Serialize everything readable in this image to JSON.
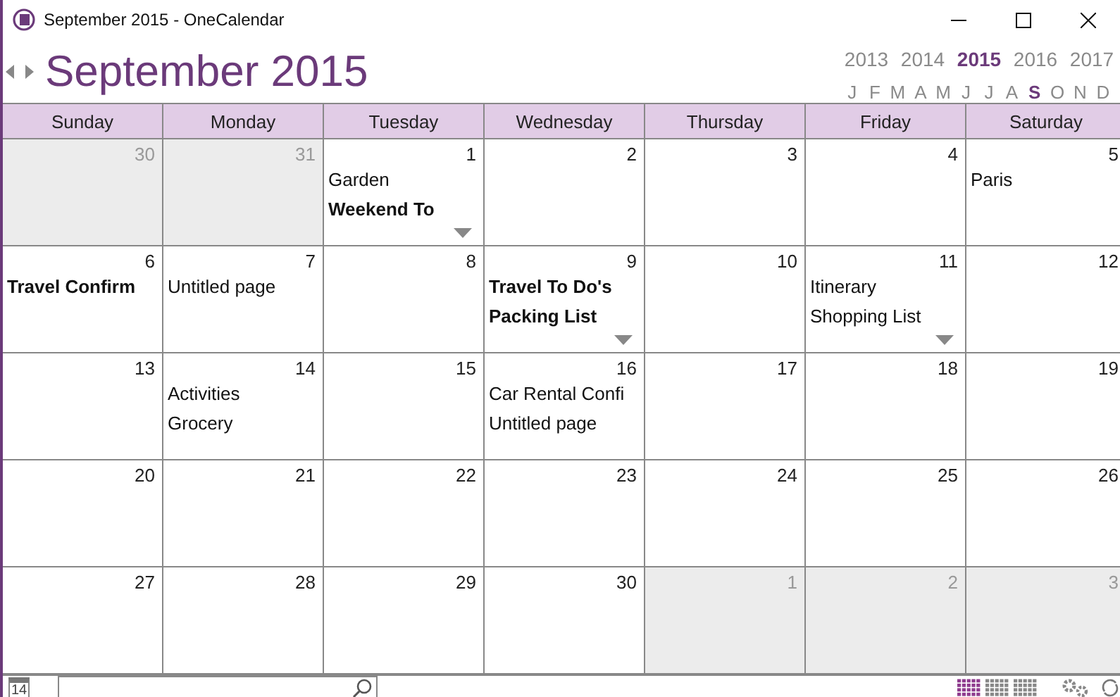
{
  "window": {
    "title": "September 2015 - OneCalendar"
  },
  "heading": "September 2015",
  "years": [
    {
      "label": "2013",
      "selected": false
    },
    {
      "label": "2014",
      "selected": false
    },
    {
      "label": "2015",
      "selected": true
    },
    {
      "label": "2016",
      "selected": false
    },
    {
      "label": "2017",
      "selected": false
    }
  ],
  "months": [
    {
      "label": "J",
      "selected": false
    },
    {
      "label": "F",
      "selected": false
    },
    {
      "label": "M",
      "selected": false
    },
    {
      "label": "A",
      "selected": false
    },
    {
      "label": "M",
      "selected": false
    },
    {
      "label": "J",
      "selected": false
    },
    {
      "label": "J",
      "selected": false
    },
    {
      "label": "A",
      "selected": false
    },
    {
      "label": "S",
      "selected": true
    },
    {
      "label": "O",
      "selected": false
    },
    {
      "label": "N",
      "selected": false
    },
    {
      "label": "D",
      "selected": false
    }
  ],
  "weekdays": [
    "Sunday",
    "Monday",
    "Tuesday",
    "Wednesday",
    "Thursday",
    "Friday",
    "Saturday"
  ],
  "weeks": [
    [
      {
        "day": "30",
        "outside": true
      },
      {
        "day": "31",
        "outside": true
      },
      {
        "day": "1",
        "outside": false,
        "more": true,
        "entries": [
          {
            "text": "Garden",
            "bold": false
          },
          {
            "text": "Weekend To",
            "bold": true
          }
        ]
      },
      {
        "day": "2",
        "outside": false
      },
      {
        "day": "3",
        "outside": false
      },
      {
        "day": "4",
        "outside": false
      },
      {
        "day": "5",
        "outside": false,
        "entries": [
          {
            "text": "Paris",
            "bold": false
          }
        ]
      }
    ],
    [
      {
        "day": "6",
        "outside": false,
        "entries": [
          {
            "text": "Travel Confirm",
            "bold": true
          }
        ]
      },
      {
        "day": "7",
        "outside": false,
        "entries": [
          {
            "text": "Untitled page",
            "bold": false
          }
        ]
      },
      {
        "day": "8",
        "outside": false
      },
      {
        "day": "9",
        "outside": false,
        "more": true,
        "entries": [
          {
            "text": "Travel To Do's",
            "bold": true
          },
          {
            "text": "Packing List",
            "bold": true
          }
        ]
      },
      {
        "day": "10",
        "outside": false
      },
      {
        "day": "11",
        "outside": false,
        "more": true,
        "entries": [
          {
            "text": "Itinerary",
            "bold": false
          },
          {
            "text": "Shopping List",
            "bold": false
          }
        ]
      },
      {
        "day": "12",
        "outside": false
      }
    ],
    [
      {
        "day": "13",
        "outside": false
      },
      {
        "day": "14",
        "outside": false,
        "entries": [
          {
            "text": "Activities",
            "bold": false
          },
          {
            "text": "Grocery",
            "bold": false
          }
        ]
      },
      {
        "day": "15",
        "outside": false
      },
      {
        "day": "16",
        "outside": false,
        "entries": [
          {
            "text": "Car Rental Confi",
            "bold": false
          },
          {
            "text": "Untitled page",
            "bold": false
          }
        ]
      },
      {
        "day": "17",
        "outside": false
      },
      {
        "day": "18",
        "outside": false
      },
      {
        "day": "19",
        "outside": false
      }
    ],
    [
      {
        "day": "20",
        "outside": false
      },
      {
        "day": "21",
        "outside": false
      },
      {
        "day": "22",
        "outside": false
      },
      {
        "day": "23",
        "outside": false
      },
      {
        "day": "24",
        "outside": false
      },
      {
        "day": "25",
        "outside": false
      },
      {
        "day": "26",
        "outside": false
      }
    ],
    [
      {
        "day": "27",
        "outside": false
      },
      {
        "day": "28",
        "outside": false
      },
      {
        "day": "29",
        "outside": false
      },
      {
        "day": "30",
        "outside": false
      },
      {
        "day": "1",
        "outside": true
      },
      {
        "day": "2",
        "outside": true
      },
      {
        "day": "3",
        "outside": true
      }
    ]
  ],
  "footer": {
    "today_icon": "14",
    "views": [
      {
        "selected": true
      },
      {
        "selected": false
      },
      {
        "selected": false
      }
    ]
  }
}
